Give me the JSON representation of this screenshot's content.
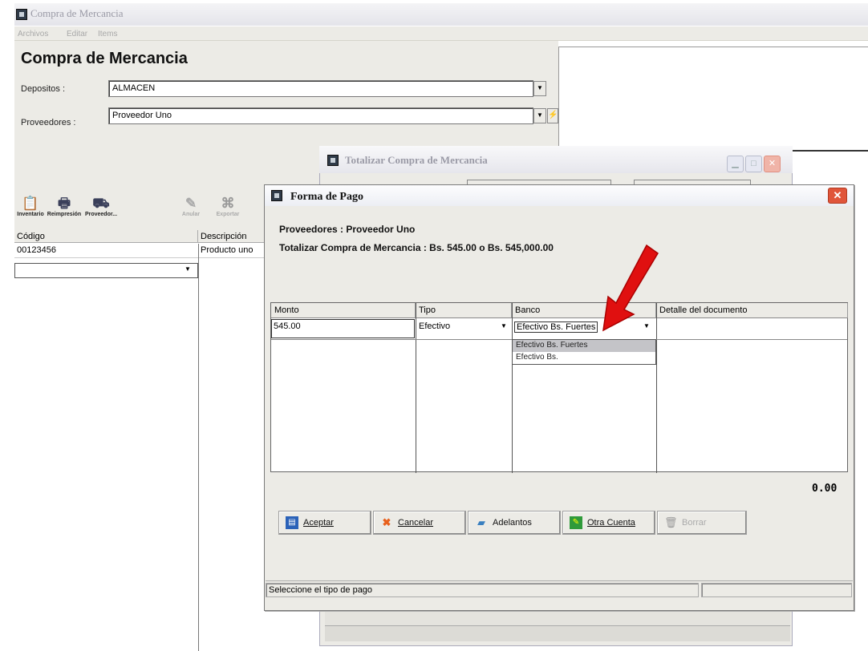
{
  "main_window": {
    "title": "Compra de Mercancia",
    "menu": [
      "Archivos",
      "Editar",
      "Items"
    ],
    "heading": "Compra de Mercancia",
    "depositos_label": "Depositos :",
    "depositos_value": "ALMACEN",
    "proveedores_label": "Proveedores :",
    "proveedores_value": "Proveedor Uno",
    "toolbar": [
      "Inventario",
      "Reimpresión",
      "Proveedor...",
      "Anular",
      "Exportar"
    ],
    "grid": {
      "headers": [
        "Código",
        "Descripción"
      ],
      "rows": [
        [
          "00123456",
          "Producto uno"
        ]
      ]
    }
  },
  "totalizar_dialog": {
    "title": "Totalizar Compra de Mercancia"
  },
  "forma_pago": {
    "title": "Forma de Pago",
    "proveedor_line": "Proveedores  : Proveedor Uno",
    "total_line": "Totalizar Compra de Mercancia  : Bs. 545.00 o Bs. 545,000.00",
    "columns": [
      "Monto",
      "Tipo",
      "Banco",
      "Detalle del documento"
    ],
    "row": {
      "monto": "545.00",
      "tipo": "Efectivo",
      "banco": "Efectivo Bs. Fuertes",
      "detalle": ""
    },
    "banco_options": [
      "Efectivo Bs. Fuertes",
      "Efectivo Bs."
    ],
    "balance": "0.00",
    "buttons": {
      "aceptar": "Aceptar",
      "cancelar": "Cancelar",
      "adelantos": "Adelantos",
      "otra_cuenta": "Otra Cuenta",
      "borrar": "Borrar"
    },
    "status": "Seleccione el tipo de pago"
  },
  "colors": {
    "arrow": "#e01010",
    "dialog_bg": "#ecebe6"
  }
}
